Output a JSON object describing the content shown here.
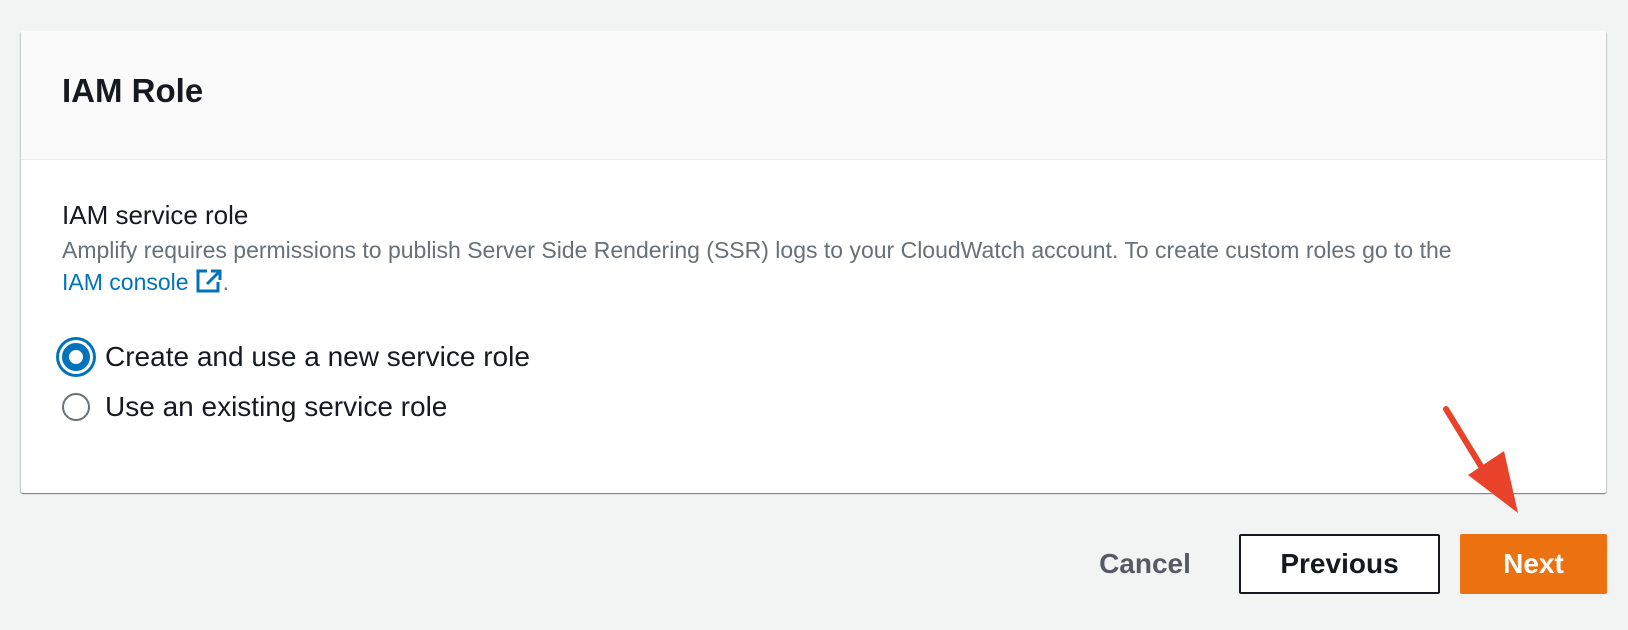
{
  "card": {
    "title": "IAM Role"
  },
  "field": {
    "label": "IAM service role",
    "description": "Amplify requires permissions to publish Server Side Rendering (SSR) logs to your CloudWatch account. To create custom roles go to the",
    "link_text": "IAM console",
    "link_icon": "external-link-icon",
    "trailing": "."
  },
  "radios": {
    "options": [
      {
        "label": "Create and use a new service role",
        "selected": true
      },
      {
        "label": "Use an existing service role",
        "selected": false
      }
    ]
  },
  "footer": {
    "cancel_label": "Cancel",
    "previous_label": "Previous",
    "next_label": "Next"
  },
  "annotation": {
    "icon": "red-arrow-icon",
    "color": "#e8432a"
  },
  "colors": {
    "primary": "#ec7211",
    "link": "#0073bb",
    "background": "#f2f3f3"
  }
}
